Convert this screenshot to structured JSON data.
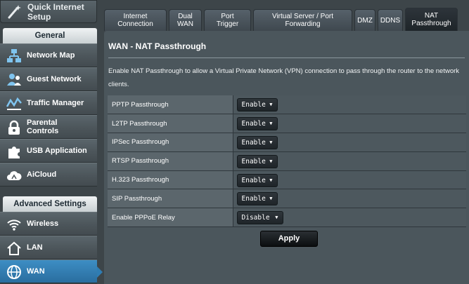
{
  "sidebar": {
    "quick_setup": {
      "label": "Quick Internet Setup",
      "icon": "wand-icon"
    },
    "general_header": "General",
    "general_items": [
      {
        "label": "Network Map",
        "icon": "network-map-icon"
      },
      {
        "label": "Guest Network",
        "icon": "guest-network-icon"
      },
      {
        "label": "Traffic Manager",
        "icon": "traffic-manager-icon"
      },
      {
        "label": "Parental Controls",
        "icon": "lock-icon"
      },
      {
        "label": "USB Application",
        "icon": "puzzle-icon"
      },
      {
        "label": "AiCloud",
        "icon": "cloud-icon"
      }
    ],
    "advanced_header": "Advanced Settings",
    "advanced_items": [
      {
        "label": "Wireless",
        "icon": "wifi-icon"
      },
      {
        "label": "LAN",
        "icon": "home-icon"
      },
      {
        "label": "WAN",
        "icon": "globe-icon",
        "active": true
      }
    ]
  },
  "tabs": [
    {
      "label": "Internet Connection"
    },
    {
      "label": "Dual WAN"
    },
    {
      "label": "Port Trigger"
    },
    {
      "label": "Virtual Server / Port Forwarding"
    },
    {
      "label": "DMZ"
    },
    {
      "label": "DDNS"
    },
    {
      "label": "NAT Passthrough",
      "active": true
    }
  ],
  "main": {
    "title": "WAN - NAT Passthrough",
    "description": "Enable NAT Passthrough to allow a Virtual Private Network (VPN) connection to pass through the router to the network clients.",
    "settings": [
      {
        "label": "PPTP Passthrough",
        "value": "Enable"
      },
      {
        "label": "L2TP Passthrough",
        "value": "Enable"
      },
      {
        "label": "IPSec Passthrough",
        "value": "Enable"
      },
      {
        "label": "RTSP Passthrough",
        "value": "Enable"
      },
      {
        "label": "H.323 Passthrough",
        "value": "Enable"
      },
      {
        "label": "SIP Passthrough",
        "value": "Enable"
      },
      {
        "label": "Enable PPPoE Relay",
        "value": "Disable"
      }
    ],
    "apply_label": "Apply"
  },
  "colors": {
    "active_nav": "#2f7db3",
    "panel_bg": "#4b565c",
    "page_bg": "#3d4549"
  }
}
